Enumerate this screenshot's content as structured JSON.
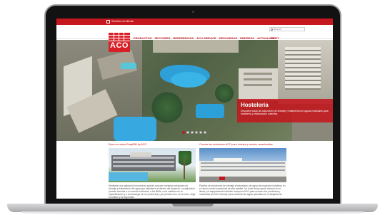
{
  "window": {
    "device": "laptop"
  },
  "topbar": {
    "contact_label": "Servicio al cliente"
  },
  "header": {
    "logo_text": "ACO",
    "search_placeholder": "Buscar",
    "nav": [
      "PRODUCTOS",
      "SECTORES",
      "REFERENCIAS",
      "ACO SERVICE",
      "DESCARGAS",
      "EMPRESA",
      "ACTUALIDAD"
    ],
    "language": "ES PT"
  },
  "hero": {
    "title": "Hostelería",
    "text": "Descubre todas las soluciones de drenaje y tratamiento de aguas residuales para hostelería y restauración colectiva.",
    "slides_count": 6,
    "active_slide": 0
  },
  "news": [
    {
      "title": "Entra en nuevo EasyBIM by ACO",
      "text": "Mediante una aplicación innovadora podrás conocer nuestras soluciones de drenaje y tratamiento del agua que satisfacen el diseño del proyecto. La aplicación permite acceder a su cuenta individual, a los BIMs, a los cambios en la especificación y a la descarga de los productos y por primera vez, en la nube, elige la calidad y la seguridad."
    },
    {
      "title": "Conoce las soluciones ACO para hoteles y centros vacacionales",
      "text": "Pasillos de soluciones de drenaje y tratamiento de agua de proyectos hoteleros en el nuevo centro vacacional de alta calidad. Un hotel del proyecto situado en el litoral y el equipamiento también incorpora ACO para conocer los productos y materiales de ACO drenaje para controlar las aguas pluviales en el alojamiento."
    }
  ],
  "colors": {
    "brand": "#c4171e",
    "accent": "#d91f26"
  }
}
